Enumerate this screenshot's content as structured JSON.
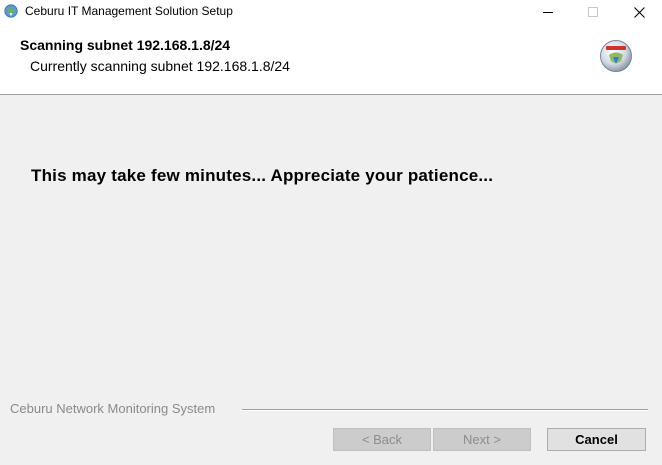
{
  "window": {
    "title": "Ceburu IT Management Solution Setup",
    "controls": {
      "minimize": "minimize-icon",
      "maximize": "maximize-icon",
      "close": "close-icon"
    }
  },
  "header": {
    "title": "Scanning subnet 192.168.1.8/24",
    "subtitle": "Currently scanning subnet 192.168.1.8/24",
    "logo": "installer-logo-icon"
  },
  "main": {
    "message": "This may take few minutes... Appreciate your patience..."
  },
  "footer": {
    "brand": "Ceburu Network Monitoring System",
    "buttons": {
      "back": "< Back",
      "next": "Next >",
      "cancel": "Cancel"
    }
  }
}
